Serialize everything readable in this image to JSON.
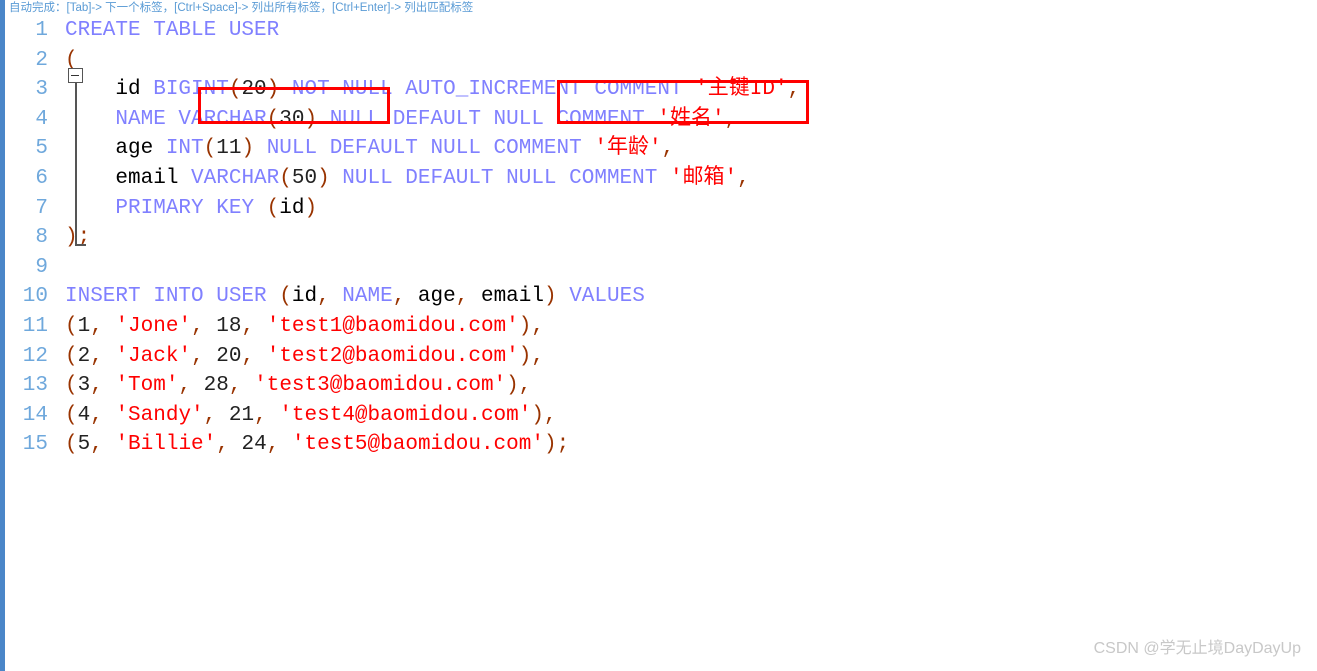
{
  "hint_bar": {
    "text": "自动完成：[Tab]-> 下一个标签，[Ctrl+Space]-> 列出所有标签，[Ctrl+Enter]-> 列出匹配标签"
  },
  "editor": {
    "language": "SQL",
    "colors": {
      "keyword": "#8080ff",
      "punctuation": "#993300",
      "string": "#ff0000",
      "plain": "#000000",
      "linenumber": "#6fa8dc",
      "annotation": "#ff0000",
      "rail": "#4a86c8",
      "background": "#ffffff"
    },
    "lines": [
      {
        "no": "1",
        "tokens": [
          {
            "t": "CREATE TABLE USER",
            "c": "kw"
          }
        ]
      },
      {
        "no": "2",
        "tokens": [
          {
            "t": "(",
            "c": "pun"
          }
        ]
      },
      {
        "no": "3",
        "tokens": [
          {
            "t": "    id ",
            "c": "plain"
          },
          {
            "t": "BIGINT",
            "c": "kw"
          },
          {
            "t": "(",
            "c": "pun"
          },
          {
            "t": "20",
            "c": "num"
          },
          {
            "t": ")",
            "c": "pun"
          },
          {
            "t": " ",
            "c": "plain"
          },
          {
            "t": "NOT NULL AUTO_INCREMENT COMMENT ",
            "c": "kw"
          },
          {
            "t": "'主键ID'",
            "c": "str"
          },
          {
            "t": ",",
            "c": "pun"
          }
        ]
      },
      {
        "no": "4",
        "tokens": [
          {
            "t": "    ",
            "c": "plain"
          },
          {
            "t": "NAME VARCHAR",
            "c": "kw"
          },
          {
            "t": "(",
            "c": "pun"
          },
          {
            "t": "30",
            "c": "num"
          },
          {
            "t": ")",
            "c": "pun"
          },
          {
            "t": " ",
            "c": "plain"
          },
          {
            "t": "NULL DEFAULT NULL COMMENT ",
            "c": "kw"
          },
          {
            "t": "'姓名'",
            "c": "str"
          },
          {
            "t": ",",
            "c": "pun"
          }
        ]
      },
      {
        "no": "5",
        "tokens": [
          {
            "t": "    age ",
            "c": "plain"
          },
          {
            "t": "INT",
            "c": "kw"
          },
          {
            "t": "(",
            "c": "pun"
          },
          {
            "t": "11",
            "c": "num"
          },
          {
            "t": ")",
            "c": "pun"
          },
          {
            "t": " ",
            "c": "plain"
          },
          {
            "t": "NULL DEFAULT NULL COMMENT ",
            "c": "kw"
          },
          {
            "t": "'年龄'",
            "c": "str"
          },
          {
            "t": ",",
            "c": "pun"
          }
        ]
      },
      {
        "no": "6",
        "tokens": [
          {
            "t": "    email ",
            "c": "plain"
          },
          {
            "t": "VARCHAR",
            "c": "kw"
          },
          {
            "t": "(",
            "c": "pun"
          },
          {
            "t": "50",
            "c": "num"
          },
          {
            "t": ")",
            "c": "pun"
          },
          {
            "t": " ",
            "c": "plain"
          },
          {
            "t": "NULL DEFAULT NULL COMMENT ",
            "c": "kw"
          },
          {
            "t": "'邮箱'",
            "c": "str"
          },
          {
            "t": ",",
            "c": "pun"
          }
        ]
      },
      {
        "no": "7",
        "tokens": [
          {
            "t": "    ",
            "c": "plain"
          },
          {
            "t": "PRIMARY KEY ",
            "c": "kw"
          },
          {
            "t": "(",
            "c": "pun"
          },
          {
            "t": "id",
            "c": "plain"
          },
          {
            "t": ")",
            "c": "pun"
          }
        ]
      },
      {
        "no": "8",
        "tokens": [
          {
            "t": ");",
            "c": "pun"
          }
        ]
      },
      {
        "no": "9",
        "tokens": []
      },
      {
        "no": "10",
        "tokens": [
          {
            "t": "INSERT INTO USER ",
            "c": "kw"
          },
          {
            "t": "(",
            "c": "pun"
          },
          {
            "t": "id",
            "c": "plain"
          },
          {
            "t": ",",
            "c": "pun"
          },
          {
            "t": " ",
            "c": "plain"
          },
          {
            "t": "NAME",
            "c": "kw"
          },
          {
            "t": ",",
            "c": "pun"
          },
          {
            "t": " age",
            "c": "plain"
          },
          {
            "t": ",",
            "c": "pun"
          },
          {
            "t": " email",
            "c": "plain"
          },
          {
            "t": ")",
            "c": "pun"
          },
          {
            "t": " ",
            "c": "plain"
          },
          {
            "t": "VALUES",
            "c": "kw"
          }
        ]
      },
      {
        "no": "11",
        "tokens": [
          {
            "t": "(",
            "c": "pun"
          },
          {
            "t": "1",
            "c": "num"
          },
          {
            "t": ",",
            "c": "pun"
          },
          {
            "t": " ",
            "c": "plain"
          },
          {
            "t": "'Jone'",
            "c": "str"
          },
          {
            "t": ",",
            "c": "pun"
          },
          {
            "t": " ",
            "c": "plain"
          },
          {
            "t": "18",
            "c": "num"
          },
          {
            "t": ",",
            "c": "pun"
          },
          {
            "t": " ",
            "c": "plain"
          },
          {
            "t": "'test1@baomidou.com'",
            "c": "str"
          },
          {
            "t": "),",
            "c": "pun"
          }
        ]
      },
      {
        "no": "12",
        "tokens": [
          {
            "t": "(",
            "c": "pun"
          },
          {
            "t": "2",
            "c": "num"
          },
          {
            "t": ",",
            "c": "pun"
          },
          {
            "t": " ",
            "c": "plain"
          },
          {
            "t": "'Jack'",
            "c": "str"
          },
          {
            "t": ",",
            "c": "pun"
          },
          {
            "t": " ",
            "c": "plain"
          },
          {
            "t": "20",
            "c": "num"
          },
          {
            "t": ",",
            "c": "pun"
          },
          {
            "t": " ",
            "c": "plain"
          },
          {
            "t": "'test2@baomidou.com'",
            "c": "str"
          },
          {
            "t": "),",
            "c": "pun"
          }
        ]
      },
      {
        "no": "13",
        "tokens": [
          {
            "t": "(",
            "c": "pun"
          },
          {
            "t": "3",
            "c": "num"
          },
          {
            "t": ",",
            "c": "pun"
          },
          {
            "t": " ",
            "c": "plain"
          },
          {
            "t": "'Tom'",
            "c": "str"
          },
          {
            "t": ",",
            "c": "pun"
          },
          {
            "t": " ",
            "c": "plain"
          },
          {
            "t": "28",
            "c": "num"
          },
          {
            "t": ",",
            "c": "pun"
          },
          {
            "t": " ",
            "c": "plain"
          },
          {
            "t": "'test3@baomidou.com'",
            "c": "str"
          },
          {
            "t": "),",
            "c": "pun"
          }
        ]
      },
      {
        "no": "14",
        "tokens": [
          {
            "t": "(",
            "c": "pun"
          },
          {
            "t": "4",
            "c": "num"
          },
          {
            "t": ",",
            "c": "pun"
          },
          {
            "t": " ",
            "c": "plain"
          },
          {
            "t": "'Sandy'",
            "c": "str"
          },
          {
            "t": ",",
            "c": "pun"
          },
          {
            "t": " ",
            "c": "plain"
          },
          {
            "t": "21",
            "c": "num"
          },
          {
            "t": ",",
            "c": "pun"
          },
          {
            "t": " ",
            "c": "plain"
          },
          {
            "t": "'test4@baomidou.com'",
            "c": "str"
          },
          {
            "t": "),",
            "c": "pun"
          }
        ]
      },
      {
        "no": "15",
        "tokens": [
          {
            "t": "(",
            "c": "pun"
          },
          {
            "t": "5",
            "c": "num"
          },
          {
            "t": ",",
            "c": "pun"
          },
          {
            "t": " ",
            "c": "plain"
          },
          {
            "t": "'Billie'",
            "c": "str"
          },
          {
            "t": ",",
            "c": "pun"
          },
          {
            "t": " ",
            "c": "plain"
          },
          {
            "t": "24",
            "c": "num"
          },
          {
            "t": ",",
            "c": "pun"
          },
          {
            "t": " ",
            "c": "plain"
          },
          {
            "t": "'test5@baomidou.com'",
            "c": "str"
          },
          {
            "t": ");",
            "c": "pun"
          }
        ]
      }
    ]
  },
  "fold": {
    "marker": "collapse-minus",
    "start_line": "2",
    "end_line": "8"
  },
  "annotations": [
    {
      "id": "bigint",
      "target_text": "BIGINT(20)",
      "color": "#ff0000"
    },
    {
      "id": "auto-increment",
      "target_text": "AUTO_INCREMENT",
      "color": "#ff0000"
    }
  ],
  "watermark": {
    "text": "CSDN @学无止境DayDayUp"
  }
}
